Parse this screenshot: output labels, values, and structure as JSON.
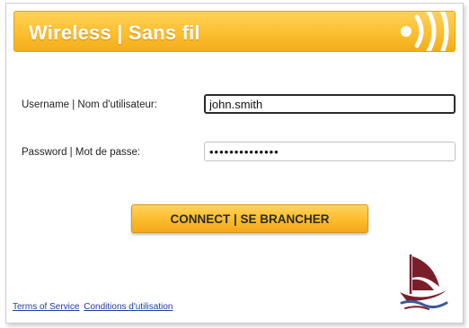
{
  "header": {
    "title": "Wireless | Sans fil",
    "icon": "wireless-signal-icon"
  },
  "form": {
    "username_label": "Username | Nom d'utilisateur:",
    "username_value": "john.smith",
    "password_label": "Password | Mot de passe:",
    "password_value": "••••••••••••••",
    "connect_label": "CONNECT | SE BRANCHER"
  },
  "footer": {
    "terms_label": "Terms of Service",
    "conditions_label": "Conditions d'utilisation"
  },
  "logo": {
    "icon": "sailing-ship-logo"
  },
  "colors": {
    "accent": "#fbbc2c",
    "header_text": "#ffffff",
    "link": "#1a3ea8",
    "logo": "#7a1f2a"
  }
}
